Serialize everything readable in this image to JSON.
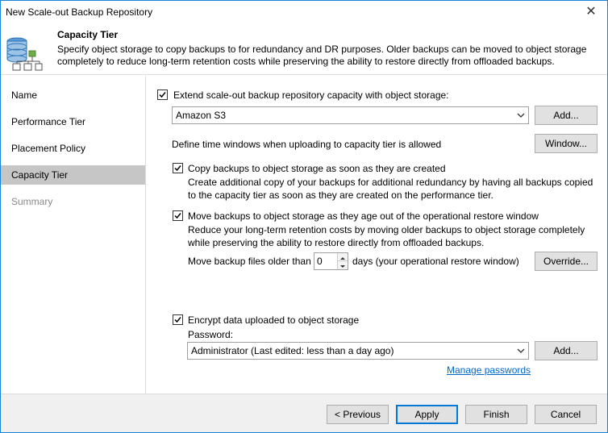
{
  "window": {
    "title": "New Scale-out Backup Repository",
    "close_glyph": "✕"
  },
  "header": {
    "icon": "repository-icon",
    "title": "Capacity Tier",
    "description": "Specify object storage to copy backups to for redundancy and DR purposes. Older backups can be moved to object storage completely to reduce long-term retention costs while preserving the ability to restore directly from offloaded backups."
  },
  "sidebar": {
    "items": [
      {
        "label": "Name",
        "state": "normal"
      },
      {
        "label": "Performance Tier",
        "state": "normal"
      },
      {
        "label": "Placement Policy",
        "state": "normal"
      },
      {
        "label": "Capacity Tier",
        "state": "active"
      },
      {
        "label": "Summary",
        "state": "disabled"
      }
    ]
  },
  "capacity": {
    "extend_checked": true,
    "extend_label": "Extend scale-out backup repository capacity with object storage:",
    "storage_value": "Amazon S3",
    "add_label": "Add...",
    "time_window_text": "Define time windows when uploading to capacity tier is allowed",
    "window_label": "Window...",
    "copy_checked": true,
    "copy_label": "Copy backups to object storage as soon as they are created",
    "copy_desc": "Create additional copy of your backups for additional redundancy by having all backups copied to the capacity tier as soon as they are created on the performance tier.",
    "move_checked": true,
    "move_label": "Move backups to object storage as they age out of the operational restore window",
    "move_desc": "Reduce your long-term retention costs by moving older backups to object storage completely while preserving the ability to restore directly from offloaded backups.",
    "move_older_label": "Move backup files older than",
    "days_value": "0",
    "days_suffix": "days (your operational restore window)",
    "override_label": "Override...",
    "encrypt_checked": true,
    "encrypt_label": "Encrypt data uploaded to object storage",
    "password_label": "Password:",
    "password_value": "Administrator (Last edited: less than a day ago)",
    "password_add_label": "Add...",
    "manage_link": "Manage passwords"
  },
  "footer": {
    "previous_label": "< Previous",
    "apply_label": "Apply",
    "finish_label": "Finish",
    "cancel_label": "Cancel"
  },
  "colors": {
    "accent": "#0078d7",
    "active_nav": "#c6c6c6",
    "link": "#0066cc"
  }
}
